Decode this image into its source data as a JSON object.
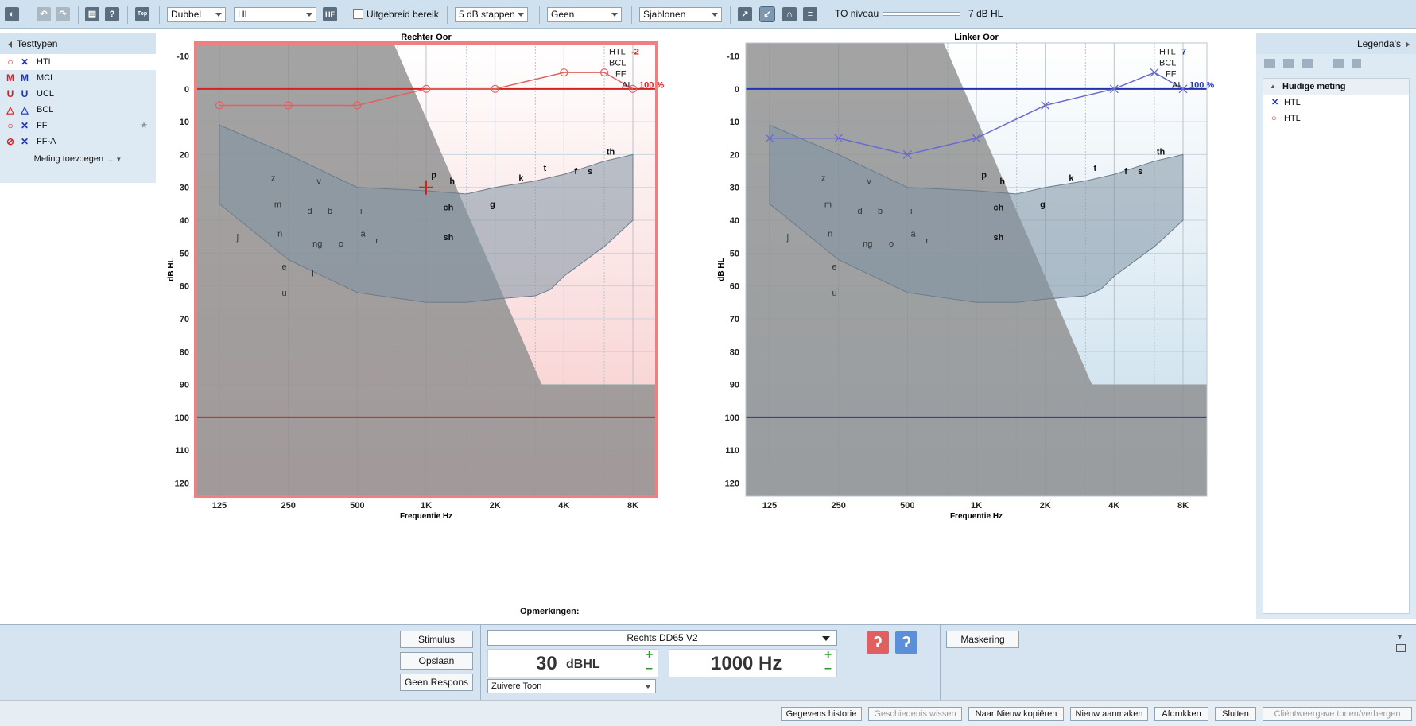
{
  "toolbar": {
    "view_mode": "Dubbel",
    "scale": "HL",
    "hf_label": "HF",
    "extended_range_label": "Uitgebreid bereik",
    "step": "5 dB stappen",
    "masking_select": "Geen",
    "templates": "Sjablonen",
    "to_level_label": "TO niveau",
    "to_level_value": "7 dB HL",
    "top_label": "Top"
  },
  "left_panel": {
    "title": "Testtypen",
    "items": [
      {
        "label": "HTL",
        "right_symbol": "○",
        "left_symbol": "✕"
      },
      {
        "label": "MCL",
        "right_symbol": "M",
        "left_symbol": "M"
      },
      {
        "label": "UCL",
        "right_symbol": "U",
        "left_symbol": "U"
      },
      {
        "label": "BCL",
        "right_symbol": "△",
        "left_symbol": "△"
      },
      {
        "label": "FF",
        "right_symbol": "○",
        "left_symbol": "✕"
      },
      {
        "label": "FF-A",
        "right_symbol": "⊘",
        "left_symbol": "✕"
      }
    ],
    "add_measurement": "Meting toevoegen ..."
  },
  "chart_data": [
    {
      "type": "line",
      "title": "Rechter Oor",
      "xlabel": "Frequentie Hz",
      "ylabel": "dB HL",
      "x_ticks": [
        "125",
        "250",
        "500",
        "1K",
        "2K",
        "4K",
        "8K"
      ],
      "y_ticks": [
        "-10",
        "0",
        "10",
        "20",
        "30",
        "40",
        "50",
        "60",
        "70",
        "80",
        "90",
        "100",
        "110",
        "120"
      ],
      "ylim": [
        -14,
        124
      ],
      "y_inverted": true,
      "series": [
        {
          "name": "HTL",
          "symbol": "circle",
          "color": "#e06060",
          "points": [
            [
              125,
              5
            ],
            [
              250,
              5
            ],
            [
              500,
              5
            ],
            [
              1000,
              0
            ],
            [
              2000,
              0
            ],
            [
              4000,
              -5
            ],
            [
              6000,
              -5
            ],
            [
              8000,
              0
            ]
          ]
        }
      ],
      "cursor": {
        "freq": 1000,
        "db": 30
      },
      "info": {
        "htl_label": "HTL",
        "htl_value": "-2",
        "bcl_label": "BCL",
        "ff_label": "FF",
        "ai_label": "AI",
        "ai_value": "100 %"
      },
      "ref_lines": [
        0,
        100
      ],
      "speech_sounds": [
        "z",
        "v",
        "m",
        "d",
        "b",
        "i",
        "j",
        "n",
        "ng",
        "o",
        "a",
        "r",
        "e",
        "l",
        "u",
        "p",
        "h",
        "ch",
        "g",
        "sh",
        "k",
        "t",
        "f",
        "s",
        "th"
      ]
    },
    {
      "type": "line",
      "title": "Linker Oor",
      "xlabel": "Frequentie Hz",
      "ylabel": "dB HL",
      "x_ticks": [
        "125",
        "250",
        "500",
        "1K",
        "2K",
        "4K",
        "8K"
      ],
      "y_ticks": [
        "-10",
        "0",
        "10",
        "20",
        "30",
        "40",
        "50",
        "60",
        "70",
        "80",
        "90",
        "100",
        "110",
        "120"
      ],
      "ylim": [
        -14,
        124
      ],
      "y_inverted": true,
      "series": [
        {
          "name": "HTL",
          "symbol": "cross",
          "color": "#6a6acc",
          "points": [
            [
              125,
              15
            ],
            [
              250,
              15
            ],
            [
              500,
              20
            ],
            [
              1000,
              15
            ],
            [
              2000,
              5
            ],
            [
              4000,
              0
            ],
            [
              6000,
              -5
            ],
            [
              8000,
              0
            ]
          ]
        }
      ],
      "info": {
        "htl_label": "HTL",
        "htl_value": "7",
        "bcl_label": "BCL",
        "ff_label": "FF",
        "ai_label": "AI",
        "ai_value": "100 %"
      },
      "ref_lines": [
        0,
        100
      ],
      "speech_sounds": [
        "z",
        "v",
        "m",
        "d",
        "b",
        "i",
        "j",
        "n",
        "ng",
        "o",
        "a",
        "r",
        "e",
        "l",
        "u",
        "p",
        "h",
        "ch",
        "g",
        "sh",
        "k",
        "t",
        "f",
        "s",
        "th"
      ]
    }
  ],
  "legend": {
    "title": "Legenda's",
    "group": "Huidige meting",
    "items": [
      {
        "label": "HTL",
        "symbol": "✕"
      },
      {
        "label": "HTL",
        "symbol": "○"
      }
    ]
  },
  "remarks_label": "Opmerkingen:",
  "controls": {
    "stimulus": "Stimulus",
    "save": "Opslaan",
    "no_response": "Geen Respons",
    "transducer": "Rechts DD65 V2",
    "level_value": "30",
    "level_unit": "dBHL",
    "freq_value": "1000 Hz",
    "tone_type": "Zuivere Toon",
    "masking": "Maskering",
    "plus": "+",
    "minus": "–"
  },
  "statusbar": {
    "history": "Gegevens historie",
    "clear_history": "Geschiedenis wissen",
    "copy_new": "Naar Nieuw kopiëren",
    "create_new": "Nieuw aanmaken",
    "print": "Afdrukken",
    "close": "Sluiten",
    "client_view": "Cliëntweergave tonen/verbergen"
  }
}
